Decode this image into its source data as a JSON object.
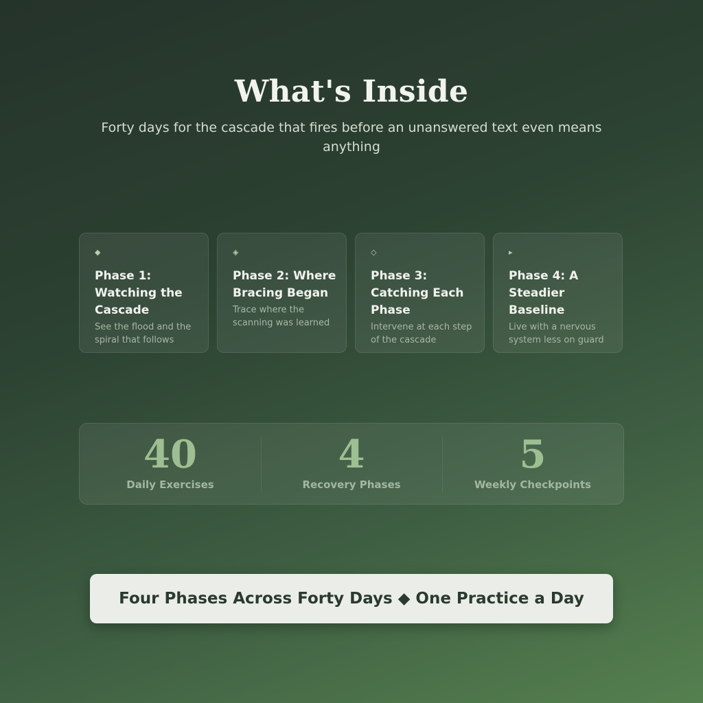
{
  "header": {
    "title": "What's Inside",
    "subtitle": "Forty days for the cascade that fires before an unanswered text even means anything"
  },
  "phases": [
    {
      "icon": "◆",
      "icon_name": "small-diamond-icon",
      "title": "Phase 1: Watching the Cascade",
      "description": "See the flood and the spiral that follows"
    },
    {
      "icon": "◈",
      "icon_name": "diamond-outline-icon",
      "title": "Phase 2: Where Bracing Began",
      "description": "Trace where the scanning was learned"
    },
    {
      "icon": "◇",
      "icon_name": "hollow-diamond-icon",
      "title": "Phase 3: Catching Each Phase",
      "description": "Intervene at each step of the cascade"
    },
    {
      "icon": "▸",
      "icon_name": "triangle-right-icon",
      "title": "Phase 4: A Steadier Baseline",
      "description": "Live with a nervous system less on guard"
    }
  ],
  "stats": [
    {
      "value": "40",
      "label": "Daily Exercises"
    },
    {
      "value": "4",
      "label": "Recovery Phases"
    },
    {
      "value": "5",
      "label": "Weekly Checkpoints"
    }
  ],
  "banner": {
    "text": "Four Phases Across Forty Days ◆ One Practice a Day"
  },
  "colors": {
    "background_top": "#25332a",
    "background_bottom": "#55804f",
    "accent_green": "#9dbf91",
    "banner_background": "#ebeee8",
    "banner_text": "#2b3a2e"
  }
}
